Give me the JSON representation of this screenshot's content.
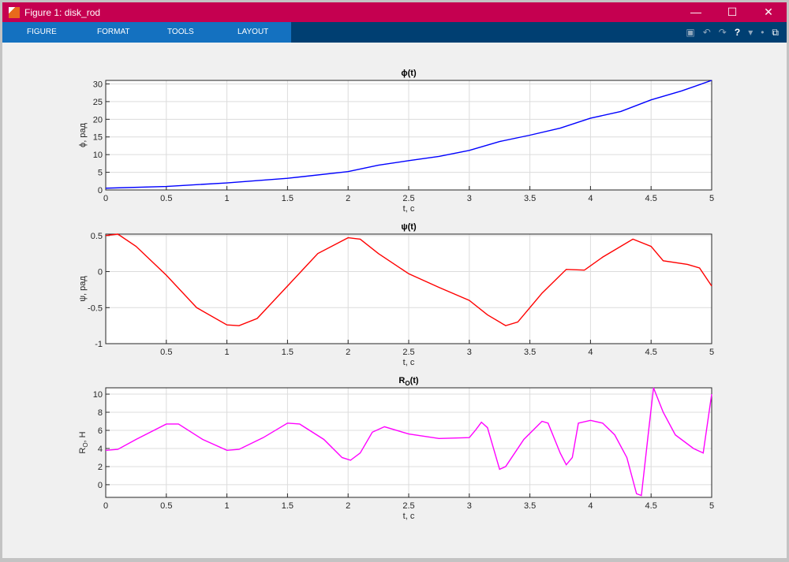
{
  "window": {
    "title": "Figure 1: disk_rod",
    "minimize": "—",
    "maximize": "☐",
    "close": "✕"
  },
  "toolstrip": {
    "tabs": [
      "FIGURE",
      "FORMAT",
      "TOOLS",
      "LAYOUT"
    ],
    "icons": [
      "save-icon",
      "undo-icon",
      "redo-icon",
      "help-icon",
      "dropdown-icon",
      "pin-icon",
      "undock-icon"
    ],
    "glyphs": [
      "▣",
      "↶",
      "↷",
      "?",
      "▾",
      "•",
      "⧉"
    ]
  },
  "chart_data": [
    {
      "type": "line",
      "title": "ϕ(t)",
      "xlabel": "t, c",
      "ylabel": "ϕ,  рад",
      "xlim": [
        0,
        5
      ],
      "ylim": [
        0,
        31
      ],
      "xticks": [
        0,
        0.5,
        1,
        1.5,
        2,
        2.5,
        3,
        3.5,
        4,
        4.5,
        5
      ],
      "yticks": [
        0,
        5,
        10,
        15,
        20,
        25,
        30
      ],
      "color": "#0000ff",
      "grid": true,
      "x": [
        0,
        0.5,
        1,
        1.5,
        2,
        2.25,
        2.5,
        2.75,
        3,
        3.25,
        3.5,
        3.75,
        4,
        4.25,
        4.5,
        4.75,
        5
      ],
      "y": [
        0.5,
        1,
        2,
        3.3,
        5.2,
        7,
        8.3,
        9.5,
        11.2,
        13.7,
        15.5,
        17.5,
        20.3,
        22.2,
        25.5,
        28,
        31
      ]
    },
    {
      "type": "line",
      "title": "ψ(t)",
      "xlabel": "t, c",
      "ylabel": "ψ,  рад",
      "xlim": [
        0,
        5
      ],
      "ylim": [
        -1,
        0.52
      ],
      "xticks": [
        0.5,
        1,
        1.5,
        2,
        2.5,
        3,
        3.5,
        4,
        4.5,
        5
      ],
      "yticks": [
        -1,
        -0.5,
        0,
        0.5
      ],
      "color": "#ff0000",
      "grid": true,
      "x": [
        0,
        0.1,
        0.25,
        0.5,
        0.75,
        1,
        1.1,
        1.25,
        1.5,
        1.75,
        2,
        2.1,
        2.25,
        2.5,
        2.75,
        3,
        3.15,
        3.3,
        3.4,
        3.6,
        3.8,
        3.95,
        4.1,
        4.35,
        4.5,
        4.6,
        4.8,
        4.9,
        5
      ],
      "y": [
        0.5,
        0.52,
        0.35,
        -0.05,
        -0.5,
        -0.74,
        -0.75,
        -0.65,
        -0.2,
        0.25,
        0.47,
        0.45,
        0.25,
        -0.03,
        -0.22,
        -0.4,
        -0.6,
        -0.75,
        -0.7,
        -0.3,
        0.03,
        0.02,
        0.2,
        0.45,
        0.35,
        0.15,
        0.1,
        0.05,
        -0.2
      ]
    },
    {
      "type": "line",
      "title": "R",
      "title_sub": "O",
      "title_suffix": "(t)",
      "xlabel": "t, c",
      "ylabel": "R",
      "ylabel_sub": "O",
      "ylabel_suffix": ",  H",
      "xlim": [
        0,
        5
      ],
      "ylim": [
        -1.4,
        10.7
      ],
      "xticks": [
        0,
        0.5,
        1,
        1.5,
        2,
        2.5,
        3,
        3.5,
        4,
        4.5,
        5
      ],
      "yticks": [
        0,
        2,
        4,
        6,
        8,
        10
      ],
      "color": "#ff00ff",
      "grid": true,
      "x": [
        0,
        0.1,
        0.25,
        0.5,
        0.6,
        0.8,
        1,
        1.1,
        1.3,
        1.5,
        1.6,
        1.8,
        1.95,
        2.02,
        2.1,
        2.2,
        2.3,
        2.5,
        2.75,
        3,
        3.05,
        3.1,
        3.15,
        3.25,
        3.3,
        3.45,
        3.6,
        3.65,
        3.75,
        3.8,
        3.85,
        3.9,
        4,
        4.1,
        4.2,
        4.3,
        4.38,
        4.42,
        4.48,
        4.52,
        4.6,
        4.7,
        4.85,
        4.93,
        5
      ],
      "y": [
        3.8,
        3.9,
        5,
        6.7,
        6.7,
        5,
        3.8,
        3.9,
        5.2,
        6.8,
        6.7,
        5,
        3,
        2.7,
        3.5,
        5.8,
        6.4,
        5.6,
        5.1,
        5.2,
        6,
        6.9,
        6.3,
        1.7,
        2,
        5,
        7,
        6.8,
        3.5,
        2.2,
        3,
        6.8,
        7.1,
        6.8,
        5.5,
        3,
        -1,
        -1.2,
        6,
        10.7,
        8,
        5.5,
        4,
        3.5,
        10
      ]
    }
  ]
}
